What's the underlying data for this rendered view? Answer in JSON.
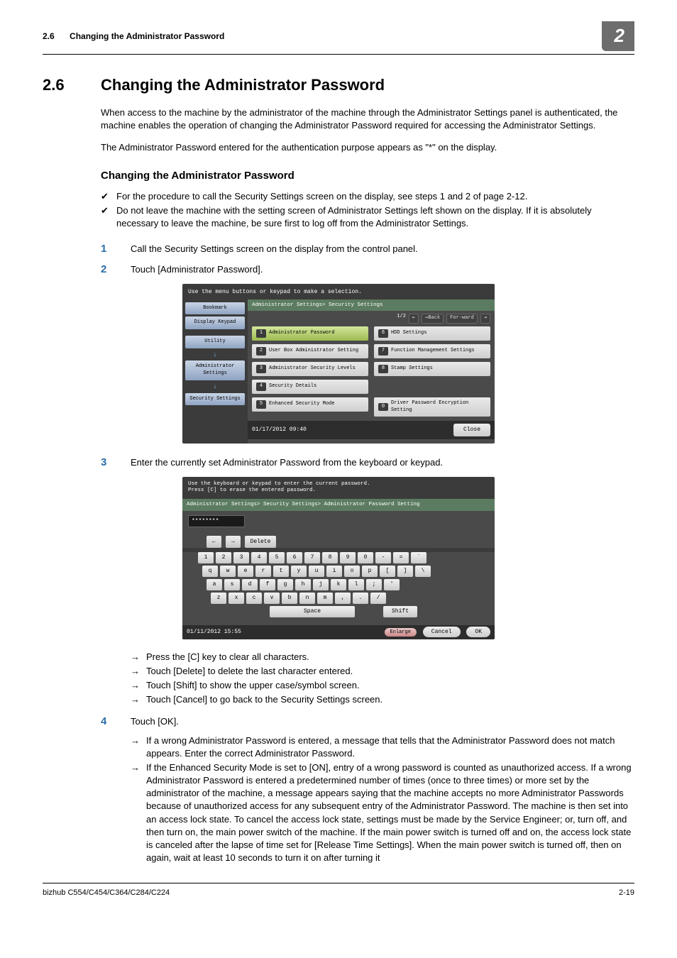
{
  "header": {
    "section_number": "2.6",
    "section_title": "Changing the Administrator Password",
    "chapter_badge": "2"
  },
  "section": {
    "number": "2.6",
    "title": "Changing the Administrator Password",
    "intro1": "When access to the machine by the administrator of the machine through the Administrator Settings panel is authenticated, the machine enables the operation of changing the Administrator Password required for accessing the Administrator Settings.",
    "intro2": "The Administrator Password entered for the authentication purpose appears as \"*\" on the display."
  },
  "subheading": "Changing the Administrator Password",
  "checks": [
    "For the procedure to call the Security Settings screen on the display, see steps 1 and 2 of page 2-12.",
    "Do not leave the machine with the setting screen of Administrator Settings left shown on the display. If it is absolutely necessary to leave the machine, be sure first to log off from the Administrator Settings."
  ],
  "steps": {
    "1": "Call the Security Settings screen on the display from the control panel.",
    "2": "Touch [Administrator Password].",
    "3": "Enter the currently set Administrator Password from the keyboard or keypad.",
    "3_sub": [
      "Press the [C] key to clear all characters.",
      "Touch [Delete] to delete the last character entered.",
      "Touch [Shift] to show the upper case/symbol screen.",
      "Touch [Cancel] to go back to the Security Settings screen."
    ],
    "4": "Touch [OK].",
    "4_sub": [
      "If a wrong Administrator Password is entered, a message that tells that the Administrator Password does not match appears. Enter the correct Administrator Password.",
      "If the Enhanced Security Mode is set to [ON], entry of a wrong password is counted as unauthorized access. If a wrong Administrator Password is entered a predetermined number of times (once to three times) or more set by the administrator of the machine, a message appears saying that the machine accepts no more Administrator Passwords because of unauthorized access for any subsequent entry of the Administrator Password. The machine is then set into an access lock state. To cancel the access lock state, settings must be made by the Service Engineer; or, turn off, and then turn on, the main power switch of the machine. If the main power switch is turned off and on, the access lock state is canceled after the lapse of time set for [Release Time Settings]. When the main power switch is turned off, then on again, wait at least 10 seconds to turn it on after turning it"
    ]
  },
  "screenshot1": {
    "instruction": "Use the menu buttons or keypad to make a selection.",
    "side": {
      "bookmark": "Bookmark",
      "display_keypad": "Display Keypad",
      "utility": "Utility",
      "admin_settings": "Administrator Settings",
      "security_settings": "Security Settings"
    },
    "breadcrumb": "Administrator Settings> Security Settings",
    "pager": {
      "page": "1/2",
      "back": "↤Back",
      "forward": "For-ward",
      "first": "⇤",
      "last": "⇥"
    },
    "left_items": [
      {
        "n": "1",
        "label": "Administrator Password"
      },
      {
        "n": "2",
        "label": "User Box Administrator Setting"
      },
      {
        "n": "3",
        "label": "Administrator Security Levels"
      },
      {
        "n": "4",
        "label": "Security Details"
      },
      {
        "n": "5",
        "label": "Enhanced Security Mode"
      }
    ],
    "right_items": [
      {
        "n": "6",
        "label": "HDD Settings"
      },
      {
        "n": "7",
        "label": "Function Management Settings"
      },
      {
        "n": "8",
        "label": "Stamp Settings"
      },
      {
        "n": "0",
        "label": "Driver Password Encryption Setting"
      }
    ],
    "datetime": "01/17/2012   09:40",
    "close": "Close"
  },
  "screenshot2": {
    "instruction_line1": "Use the keyboard or keypad to enter the current password.",
    "instruction_line2": "Press [C] to erase the entered password.",
    "breadcrumb": "Administrator Settings> Security Settings> Administrator Password Setting",
    "input_value": "********",
    "tools": {
      "left": "←",
      "right": "→",
      "delete": "Delete"
    },
    "rows": [
      [
        "1",
        "2",
        "3",
        "4",
        "5",
        "6",
        "7",
        "8",
        "9",
        "0",
        "-",
        "=",
        "`"
      ],
      [
        "q",
        "w",
        "e",
        "r",
        "t",
        "y",
        "u",
        "i",
        "o",
        "p",
        "[",
        "]",
        "\\"
      ],
      [
        "a",
        "s",
        "d",
        "f",
        "g",
        "h",
        "j",
        "k",
        "l",
        ";",
        "'"
      ],
      [
        "z",
        "x",
        "c",
        "v",
        "b",
        "n",
        "m",
        ",",
        ".",
        "/"
      ]
    ],
    "space": "Space",
    "shift": "Shift",
    "datetime": "01/11/2012   15:55",
    "enlarge": "Enlarge",
    "cancel": "Cancel",
    "ok": "OK"
  },
  "footer": {
    "left": "bizhub C554/C454/C364/C284/C224",
    "right": "2-19"
  }
}
